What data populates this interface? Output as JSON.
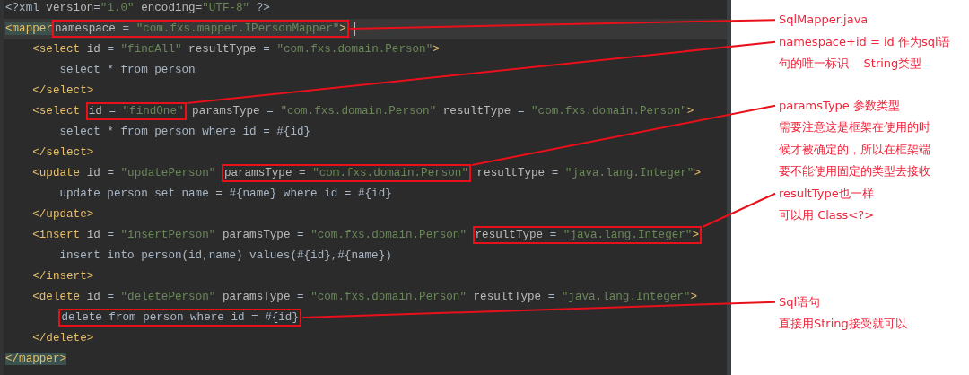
{
  "editor": {
    "lines": [
      {
        "tokens": [
          {
            "kind": "plain",
            "text": "<?xml "
          },
          {
            "kind": "attr",
            "text": "version"
          },
          {
            "kind": "op",
            "text": "="
          },
          {
            "kind": "str",
            "text": "\"1.0\""
          },
          {
            "kind": "attr",
            "text": " encoding"
          },
          {
            "kind": "op",
            "text": "="
          },
          {
            "kind": "str",
            "text": "\"UTF-8\""
          },
          {
            "kind": "plain",
            "text": " ?>"
          }
        ]
      },
      {
        "current": true,
        "cursor": true,
        "tokens": [
          {
            "kind": "tag",
            "text": "<mapper",
            "matched": true
          },
          {
            "kind": "boxed",
            "tokens": [
              {
                "kind": "attr",
                "text": "namespace"
              },
              {
                "kind": "op",
                "text": " = "
              },
              {
                "kind": "str",
                "text": "\"com.fxs.mapper.IPersonMapper\""
              },
              {
                "kind": "tag",
                "text": ">"
              }
            ]
          }
        ]
      },
      {
        "tokens": [
          {
            "kind": "tag",
            "text": "    <select"
          },
          {
            "kind": "attr",
            "text": " id"
          },
          {
            "kind": "op",
            "text": " = "
          },
          {
            "kind": "str",
            "text": "\"findAll\""
          },
          {
            "kind": "attr",
            "text": " resultType"
          },
          {
            "kind": "op",
            "text": " = "
          },
          {
            "kind": "str",
            "text": "\"com.fxs.domain.Person\""
          },
          {
            "kind": "tag",
            "text": ">"
          }
        ]
      },
      {
        "tokens": [
          {
            "kind": "plain",
            "text": "        select * from person"
          }
        ]
      },
      {
        "tokens": [
          {
            "kind": "tag",
            "text": "    </select>"
          }
        ]
      },
      {
        "tokens": [
          {
            "kind": "tag",
            "text": "    <select "
          },
          {
            "kind": "boxed",
            "tokens": [
              {
                "kind": "attr",
                "text": "id"
              },
              {
                "kind": "op",
                "text": " = "
              },
              {
                "kind": "str",
                "text": "\"findOne\""
              }
            ]
          },
          {
            "kind": "attr",
            "text": " paramsType"
          },
          {
            "kind": "op",
            "text": " = "
          },
          {
            "kind": "str",
            "text": "\"com.fxs.domain.Person\""
          },
          {
            "kind": "attr",
            "text": " resultType"
          },
          {
            "kind": "op",
            "text": " = "
          },
          {
            "kind": "str",
            "text": "\"com.fxs.domain.Person\""
          },
          {
            "kind": "tag",
            "text": ">"
          }
        ]
      },
      {
        "tokens": [
          {
            "kind": "plain",
            "text": "        select * from person where id = #{id}"
          }
        ]
      },
      {
        "tokens": [
          {
            "kind": "tag",
            "text": "    </select>"
          }
        ]
      },
      {
        "tokens": [
          {
            "kind": "tag",
            "text": "    <update"
          },
          {
            "kind": "attr",
            "text": " id"
          },
          {
            "kind": "op",
            "text": " = "
          },
          {
            "kind": "str",
            "text": "\"updatePerson\" "
          },
          {
            "kind": "boxed",
            "tokens": [
              {
                "kind": "attr",
                "text": "paramsType"
              },
              {
                "kind": "op",
                "text": " = "
              },
              {
                "kind": "str",
                "text": "\"com.fxs.domain.Person\""
              }
            ]
          },
          {
            "kind": "attr",
            "text": " resultType"
          },
          {
            "kind": "op",
            "text": " = "
          },
          {
            "kind": "str",
            "text": "\"java.lang.Integer\""
          },
          {
            "kind": "tag",
            "text": ">"
          }
        ]
      },
      {
        "tokens": [
          {
            "kind": "plain",
            "text": "        update person set name = #{name} where id = #{id}"
          }
        ]
      },
      {
        "tokens": [
          {
            "kind": "tag",
            "text": "    </update>"
          }
        ]
      },
      {
        "tokens": [
          {
            "kind": "tag",
            "text": "    <insert"
          },
          {
            "kind": "attr",
            "text": " id"
          },
          {
            "kind": "op",
            "text": " = "
          },
          {
            "kind": "str",
            "text": "\"insertPerson\""
          },
          {
            "kind": "attr",
            "text": " paramsType"
          },
          {
            "kind": "op",
            "text": " = "
          },
          {
            "kind": "str",
            "text": "\"com.fxs.domain.Person\" "
          },
          {
            "kind": "boxed",
            "tokens": [
              {
                "kind": "attr",
                "text": "resultType"
              },
              {
                "kind": "op",
                "text": " = "
              },
              {
                "kind": "str",
                "text": "\"java.lang.Integer\""
              },
              {
                "kind": "tag",
                "text": ">"
              }
            ]
          }
        ]
      },
      {
        "tokens": [
          {
            "kind": "plain",
            "text": "        insert into person(id,name) values(#{id},#{name})"
          }
        ]
      },
      {
        "tokens": [
          {
            "kind": "tag",
            "text": "    </insert>"
          }
        ]
      },
      {
        "tokens": [
          {
            "kind": "tag",
            "text": "    <delete"
          },
          {
            "kind": "attr",
            "text": " id"
          },
          {
            "kind": "op",
            "text": " = "
          },
          {
            "kind": "str",
            "text": "\"deletePerson\""
          },
          {
            "kind": "attr",
            "text": " paramsType"
          },
          {
            "kind": "op",
            "text": " = "
          },
          {
            "kind": "str",
            "text": "\"com.fxs.domain.Person\""
          },
          {
            "kind": "attr",
            "text": " resultType"
          },
          {
            "kind": "op",
            "text": " = "
          },
          {
            "kind": "str",
            "text": "\"java.lang.Integer\""
          },
          {
            "kind": "tag",
            "text": ">"
          }
        ]
      },
      {
        "tokens": [
          {
            "kind": "boxed",
            "tokens": [
              {
                "kind": "plain",
                "text": "        delete from person where id = #{id}"
              }
            ]
          }
        ]
      },
      {
        "tokens": [
          {
            "kind": "tag",
            "text": "    </delete>"
          }
        ]
      },
      {
        "tokens": [
          {
            "kind": "tag",
            "text": "</mapper>",
            "matched": true
          }
        ]
      }
    ]
  },
  "annotations": [
    {
      "lines": [
        {
          "text": "SqlMapper.java",
          "leader": true
        },
        {
          "text": "namespace+id = id 作为sql语",
          "leader": true
        },
        {
          "text": "句的唯一标识    String类型",
          "leader": false
        }
      ]
    },
    {
      "lines": [
        {
          "text": "paramsType 参数类型",
          "leader": true
        },
        {
          "text": "需要注意这是框架在使用的时",
          "leader": false
        },
        {
          "text": "候才被确定的，所以在框架端",
          "leader": false
        },
        {
          "text": "要不能使用固定的类型去接收",
          "leader": false
        },
        {
          "text": "resultType也一样",
          "leader": true
        },
        {
          "text": "可以用 Class<?>",
          "leader": false
        }
      ]
    },
    {
      "lines": [
        {
          "text": "Sql语句",
          "leader": true
        },
        {
          "text": "直接用String接受就可以",
          "leader": false
        }
      ]
    }
  ]
}
